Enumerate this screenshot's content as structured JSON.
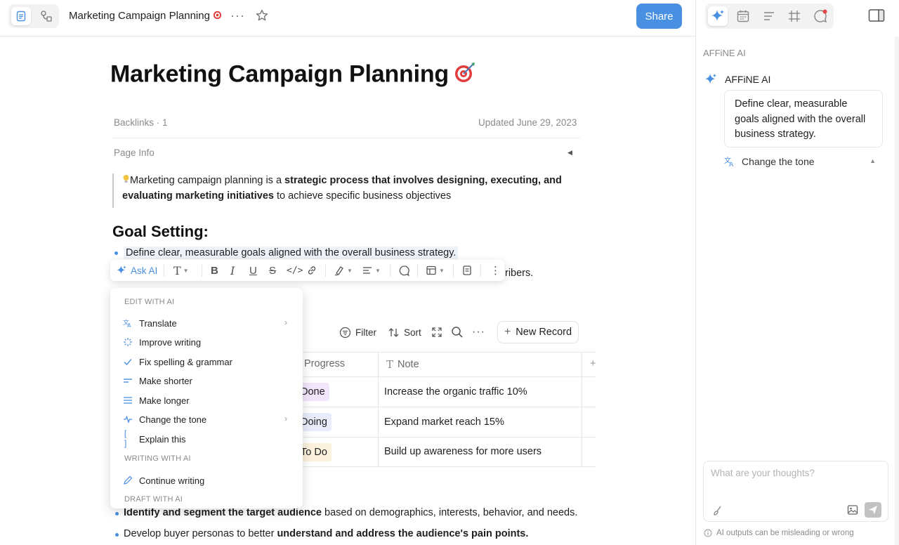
{
  "topbar": {
    "doc_title": "Marketing Campaign Planning",
    "more_label": "···",
    "share_label": "Share"
  },
  "doc": {
    "title": "Marketing Campaign Planning",
    "backlinks": "Backlinks · 1",
    "updated": "Updated June 29, 2023",
    "page_info": "Page Info",
    "quote": {
      "prefix": "Marketing campaign planning is a ",
      "bold": "strategic process that involves designing, executing, and evaluating marketing initiatives",
      "suffix": " to achieve specific business objectives"
    },
    "h2_goal": "Goal Setting:",
    "bullet_1": "Define clear, measurable goals aligned with the overall business strategy.",
    "bullet_2_tail": "ribers.",
    "bullet_3": {
      "bold": "Identify and segment the target audience",
      "rest": " based on demographics, interests, behavior, and needs."
    },
    "bullet_4": {
      "prefix": "Develop buyer personas to better ",
      "bold": "understand and address the audience's pain points."
    }
  },
  "toolbar": {
    "ask_ai": "Ask AI"
  },
  "database": {
    "filter": "Filter",
    "sort": "Sort",
    "new_record": "New Record",
    "columns": [
      "Progress",
      "Note"
    ],
    "rows": [
      {
        "progress": "Done",
        "note": "Increase the organic traffic 10%",
        "color": "#f2e6fb"
      },
      {
        "progress": "Doing",
        "note": "Expand market reach 15%",
        "color": "#e8ecfb"
      },
      {
        "progress": "To Do",
        "note": "Build up awareness for more users",
        "color": "#fbf1dc"
      }
    ]
  },
  "ai_menu": {
    "edit_section": "EDIT WITH AI",
    "items": [
      {
        "label": "Translate",
        "icon": "translate-icon"
      },
      {
        "label": "Improve writing",
        "icon": "sparkle-icon"
      },
      {
        "label": "Fix spelling & grammar",
        "icon": "check-icon"
      },
      {
        "label": "Make shorter",
        "icon": "shorter-icon"
      },
      {
        "label": "Make longer",
        "icon": "longer-icon"
      },
      {
        "label": "Change the tone",
        "icon": "tone-icon"
      },
      {
        "label": "Explain this",
        "icon": "brackets-icon"
      }
    ],
    "writing_section": "WRITING WITH AI",
    "continue_writing": "Continue writing",
    "draft_section": "DRAFT WITH AI"
  },
  "right_panel": {
    "section_label": "AFFiNE AI",
    "ai_name": "AFFiNE AI",
    "ai_message": "Define clear, measurable goals aligned with the overall business strategy.",
    "action_label": "Change the tone",
    "input_placeholder": "What are your thoughts?",
    "disclaimer": "AI outputs can be misleading or wrong"
  },
  "colors": {
    "accent": "#4a90e2",
    "share_bg": "#4a90e2"
  }
}
